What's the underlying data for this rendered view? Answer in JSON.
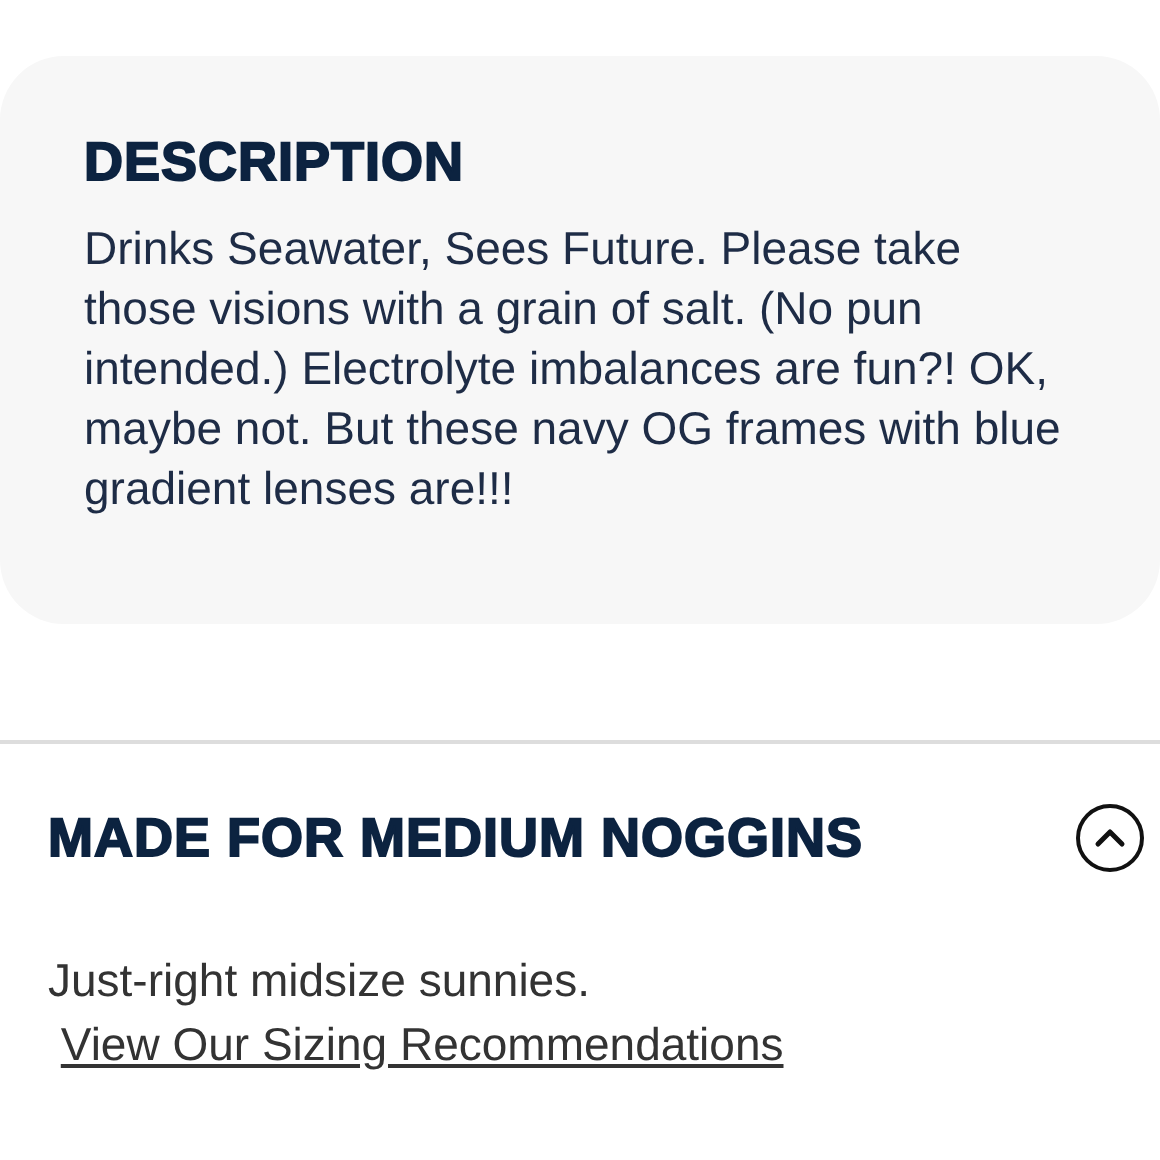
{
  "description": {
    "heading": "DESCRIPTION",
    "text": "Drinks Seawater, Sees Future. Please take those visions with a grain of salt. (No pun intended.) Electrolyte imbalances are fun?! OK, maybe not. But these navy OG frames with blue gradient lenses are!!!"
  },
  "sizing": {
    "heading": "MADE FOR MEDIUM NOGGINS",
    "expanded": true,
    "text": "Just-right midsize sunnies.",
    "link": "View Our Sizing Recommendations"
  }
}
